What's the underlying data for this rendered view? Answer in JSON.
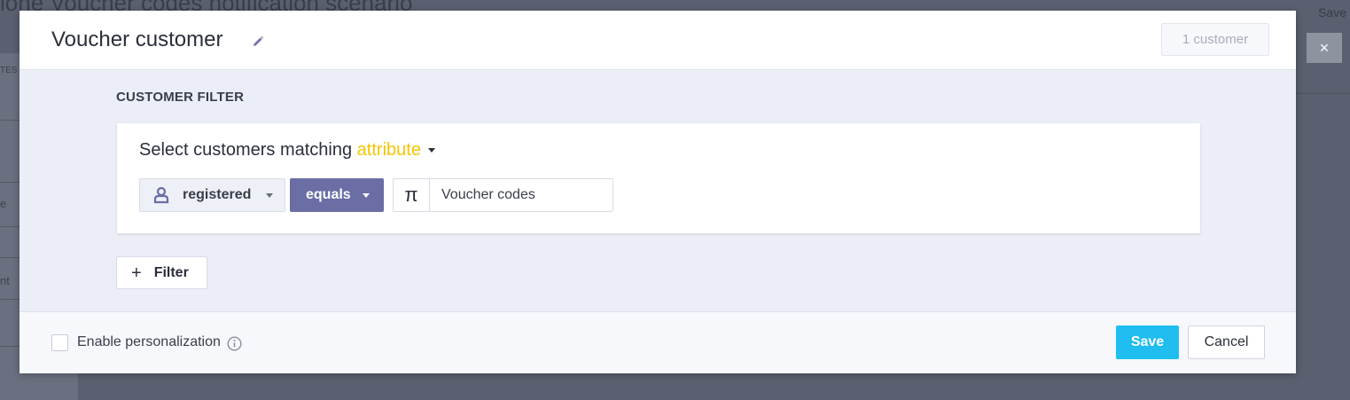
{
  "background": {
    "title_fragment": "lone Voucher codes notification scenario",
    "save_label": "Save",
    "close_glyph": "×",
    "sidebar_fragments": [
      "TES",
      "e",
      "nt"
    ]
  },
  "modal": {
    "title": "Voucher customer",
    "customer_count": "1 customer",
    "section_label": "CUSTOMER FILTER",
    "filter": {
      "heading_prefix": "Select customers matching",
      "heading_mode": "attribute",
      "attribute": "registered",
      "operator": "equals",
      "type_symbol": "π",
      "value": "Voucher codes"
    },
    "add_filter": {
      "plus": "+",
      "label": "Filter"
    },
    "footer": {
      "personalization_label": "Enable personalization",
      "personalization_checked": false,
      "save_label": "Save",
      "cancel_label": "Cancel"
    }
  },
  "colors": {
    "accent_yellow": "#f5c400",
    "operator_purple": "#6a6ea5",
    "save_blue": "#1fbdf0"
  }
}
